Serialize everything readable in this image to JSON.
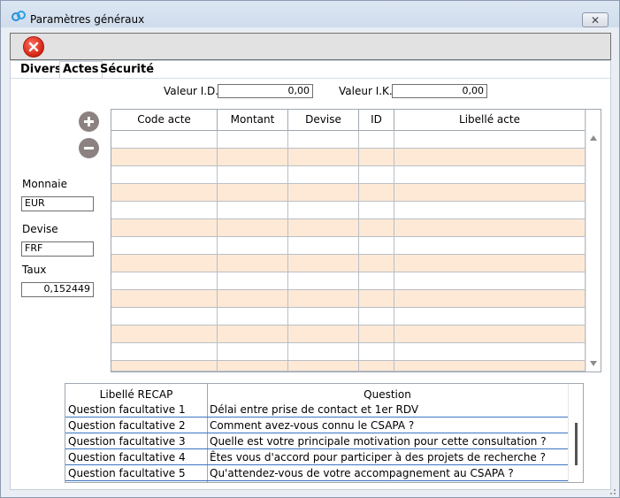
{
  "window": {
    "title": "Paramètres généraux",
    "close_glyph": "✕"
  },
  "icons": {
    "app": "app-logo-icon",
    "exit": "exit-red-x-icon",
    "add": "plus-circle-icon",
    "remove": "minus-circle-icon"
  },
  "colors": {
    "toolbar_bg": "#e2e2e2",
    "row_alt": "#fde9d6",
    "exit_red": "#d42514",
    "round_btn": "#8b8281",
    "question_row_border": "#3b76c0"
  },
  "tabs": [
    {
      "label": "Divers"
    },
    {
      "label": "Actes"
    },
    {
      "label": "Sécurité"
    }
  ],
  "values": {
    "id_label": "Valeur I.D.",
    "id_value": "0,00",
    "ik_label": "Valeur I.K.",
    "ik_value": "0,00"
  },
  "currency": {
    "monnaie_label": "Monnaie",
    "monnaie_value": "EUR",
    "devise_label": "Devise",
    "devise_value": "FRF",
    "taux_label": "Taux",
    "taux_value": "0,152449"
  },
  "actes_table": {
    "columns": [
      "Code acte",
      "Montant",
      "Devise",
      "ID",
      "Libellé acte"
    ]
  },
  "recap": {
    "headers": [
      "Libellé RECAP",
      "Question"
    ],
    "rows": [
      {
        "label": "Question facultative 1",
        "question": "Délai entre prise de contact et 1er RDV"
      },
      {
        "label": "Question facultative 2",
        "question": "Comment avez-vous connu le CSAPA ?"
      },
      {
        "label": "Question facultative 3",
        "question": "Quelle est votre principale motivation pour cette consultation ?"
      },
      {
        "label": "Question facultative 4",
        "question": "Êtes vous d'accord pour participer à des projets de recherche ?"
      },
      {
        "label": "Question facultative 5",
        "question": "Qu'attendez-vous de votre accompagnement au CSAPA ?"
      }
    ]
  }
}
